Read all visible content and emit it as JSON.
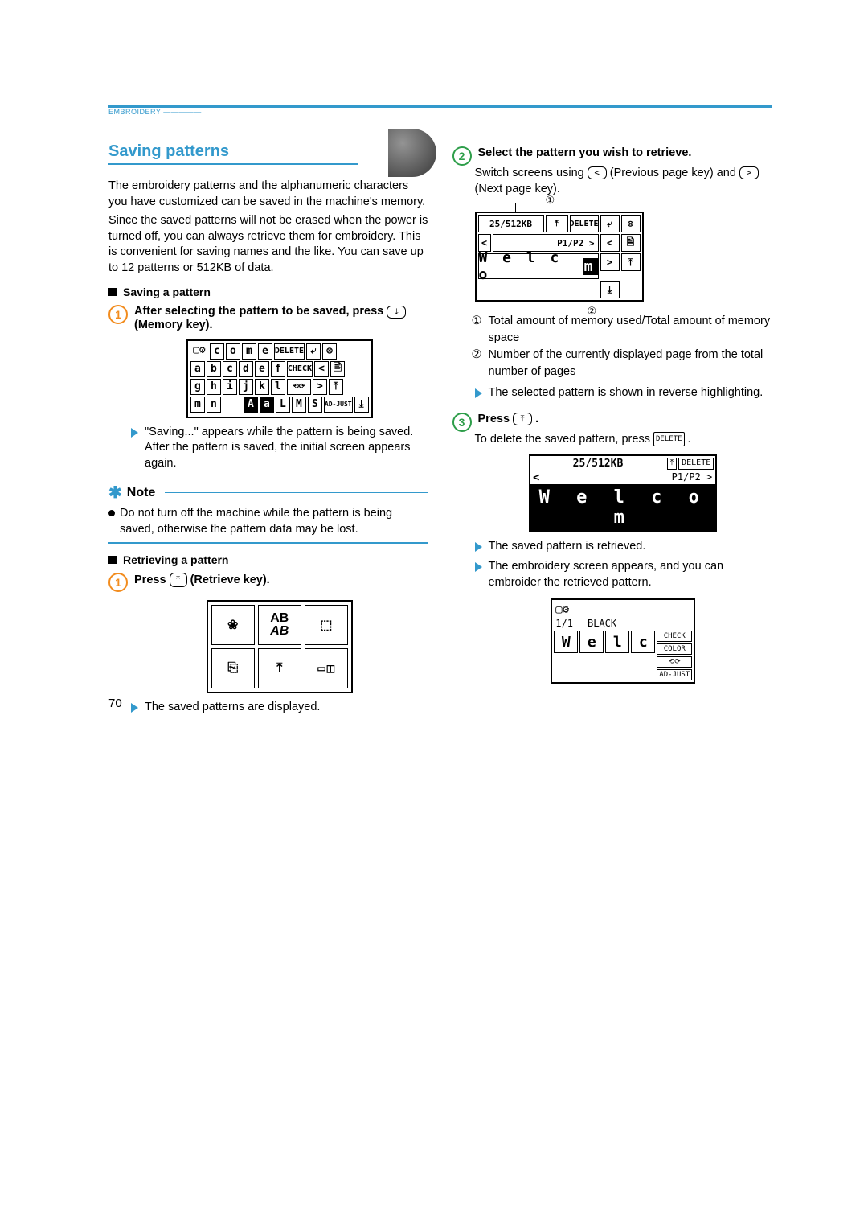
{
  "header": {
    "tab": "EMBROIDERY"
  },
  "section_title": "Saving patterns",
  "intro_p1": "The embroidery patterns and the alphanumeric characters you have customized can be saved in the machine's memory.",
  "intro_p2": "Since the saved patterns will not be erased when the power is turned off, you can always retrieve them for embroidery. This is convenient for saving names and the like. You can save up to 12 patterns or 512KB of data.",
  "saving": {
    "heading": "Saving a pattern",
    "step1_a": "After selecting the pattern to be saved, press ",
    "step1_b": " (Memory key).",
    "lcd": {
      "top": [
        "c",
        "o",
        "m",
        "e"
      ],
      "top_btn": "DELETE",
      "row1": [
        "a",
        "b",
        "c",
        "d",
        "e",
        "f"
      ],
      "row1_btn": "CHECK",
      "row2": [
        "g",
        "h",
        "i",
        "j",
        "k",
        "l"
      ],
      "row3": [
        "m",
        "n"
      ],
      "row3_btns": [
        "A",
        "a",
        "L",
        "M",
        "S",
        "AD-JUST"
      ]
    },
    "result": "\"Saving...\" appears while the pattern is being saved. After the pattern is saved, the initial screen appears again.",
    "note_title": "Note",
    "note_body": "Do not turn off the machine while the pattern is being saved, otherwise the pattern data may be lost."
  },
  "retrieving": {
    "heading": "Retrieving a pattern",
    "step1_a": "Press ",
    "step1_b": " (Retrieve key).",
    "menu_label_ab": "AB",
    "result": "The saved patterns are displayed."
  },
  "select": {
    "step2": "Select the pattern you wish to retrieve.",
    "switch_a": "Switch screens using ",
    "switch_b": " (Previous page key) and ",
    "switch_c": " (Next page key).",
    "panel": {
      "memory": "25/512KB",
      "delete": "DELETE",
      "page": "P1/P2",
      "word": "W e l c o m"
    },
    "callout1": "Total amount of memory used/Total amount of memory space",
    "callout2": "Number of the currently displayed page from the total number of pages",
    "result": "The selected pattern is shown in reverse highlighting."
  },
  "confirm": {
    "step3_a": "Press ",
    "step3_b": ".",
    "step3_note": "To delete the saved pattern, press ",
    "panel": {
      "memory": "25/512KB",
      "delete": "DELETE",
      "page": "P1/P2",
      "word": "W e l c o m"
    },
    "result1": "The saved pattern is retrieved.",
    "result2": "The embroidery screen appears, and you can embroider the retrieved pattern.",
    "final": {
      "count": "1/1",
      "color": "BLACK",
      "letters": [
        "W",
        "e",
        "l",
        "c"
      ],
      "side": [
        "CHECK",
        "COLOR",
        "⟲⟳",
        "AD-JUST"
      ]
    }
  },
  "page_number": "70"
}
